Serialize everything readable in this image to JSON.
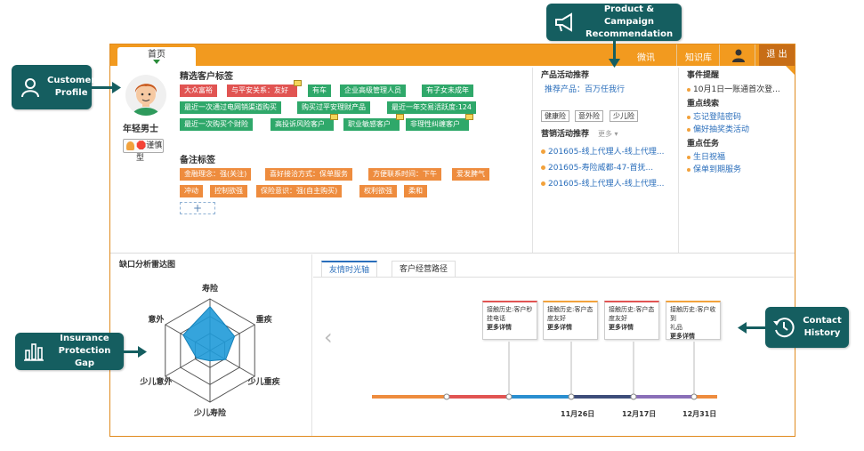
{
  "callouts": {
    "customer_profile": "Customer Profile",
    "product_campaign": "Product  & Campaign Recommendation",
    "insurance_gap": "Insurance Protection Gap",
    "contact_history": "Contact History"
  },
  "topbar": {
    "active_tab": "首页",
    "weixin": "微讯",
    "knowledge": "知识库",
    "exit": "退 出"
  },
  "profile": {
    "persona": "年轻男士",
    "type_button": "🛑谨慎型"
  },
  "selected_tags": {
    "title": "精选客户标签",
    "row1": [
      "大众富裕",
      "与平安关系：友好",
      "有车",
      "企业高级管理人员",
      "有子女未成年"
    ],
    "row2": [
      "最近一次通过电网销渠道购买",
      "购买过平安理财产品",
      "最近一年交易活跃度:124"
    ],
    "row3": [
      "最近一次购买个财险",
      "高投诉风险客户",
      "职业敏感客户",
      "非理性纠缠客户"
    ]
  },
  "remark_tags": {
    "title": "备注标签",
    "row1": [
      "金融理念：强(关注)",
      "喜好接洽方式：保单服务",
      "方便联系时间：下午",
      "爱发脾气"
    ],
    "row2": [
      "冲动",
      "控制欲强",
      "保险意识：强(自主购买)",
      "权利欲强",
      "柔和"
    ],
    "add": "+"
  },
  "product": {
    "title": "产品活动推荐",
    "recommend_label": "推荐产品：",
    "recommend_value": "百万任我行",
    "buttons": [
      "健康险",
      "意外险",
      "少儿险"
    ],
    "campaign_title": "营销活动推荐",
    "more": "更多 ▾",
    "campaigns": [
      "201605-线上代理人-线上代理...",
      "201605-寿险威都-47-首抚...",
      "201605-线上代理人-线上代理..."
    ]
  },
  "events": {
    "title": "事件提醒",
    "item": "10月1日一账通首次登...",
    "leads_title": "重点线索",
    "leads": [
      "忘记登陆密码",
      "偏好抽奖类活动"
    ],
    "tasks_title": "重点任务",
    "tasks": [
      "生日祝福",
      "保单到期服务"
    ]
  },
  "radar": {
    "title": "缺口分析雷达图",
    "axes": [
      "寿险",
      "重疾",
      "少儿重疾",
      "少儿寿险",
      "少儿意外",
      "意外"
    ],
    "values": [
      0.85,
      0.55,
      0.35,
      0.2,
      0.3,
      0.6
    ]
  },
  "history": {
    "tabs": [
      "友情时光轴",
      "客户经营路径"
    ],
    "prev": "‹",
    "cards": [
      {
        "l1": "接触历史:客户秒",
        "l2": "挂电话",
        "more": "更多详情"
      },
      {
        "l1": "接触历史:客户态",
        "l2": "度友好",
        "more": "更多详情"
      },
      {
        "l1": "接触历史:客户态",
        "l2": "度友好",
        "more": "更多详情"
      },
      {
        "l1": "接触历史:客户收到",
        "l2": "礼品",
        "more": "更多详情"
      }
    ],
    "dates": [
      "11月26日",
      "12月17日",
      "12月31日"
    ]
  },
  "colors": {
    "callout": "#155e60",
    "accent": "#f29a1f",
    "tag_red": "#e15452",
    "tag_green": "#2fa86a",
    "tag_orange": "#ee8c3e",
    "radar_fill": "#1f9ad8"
  }
}
